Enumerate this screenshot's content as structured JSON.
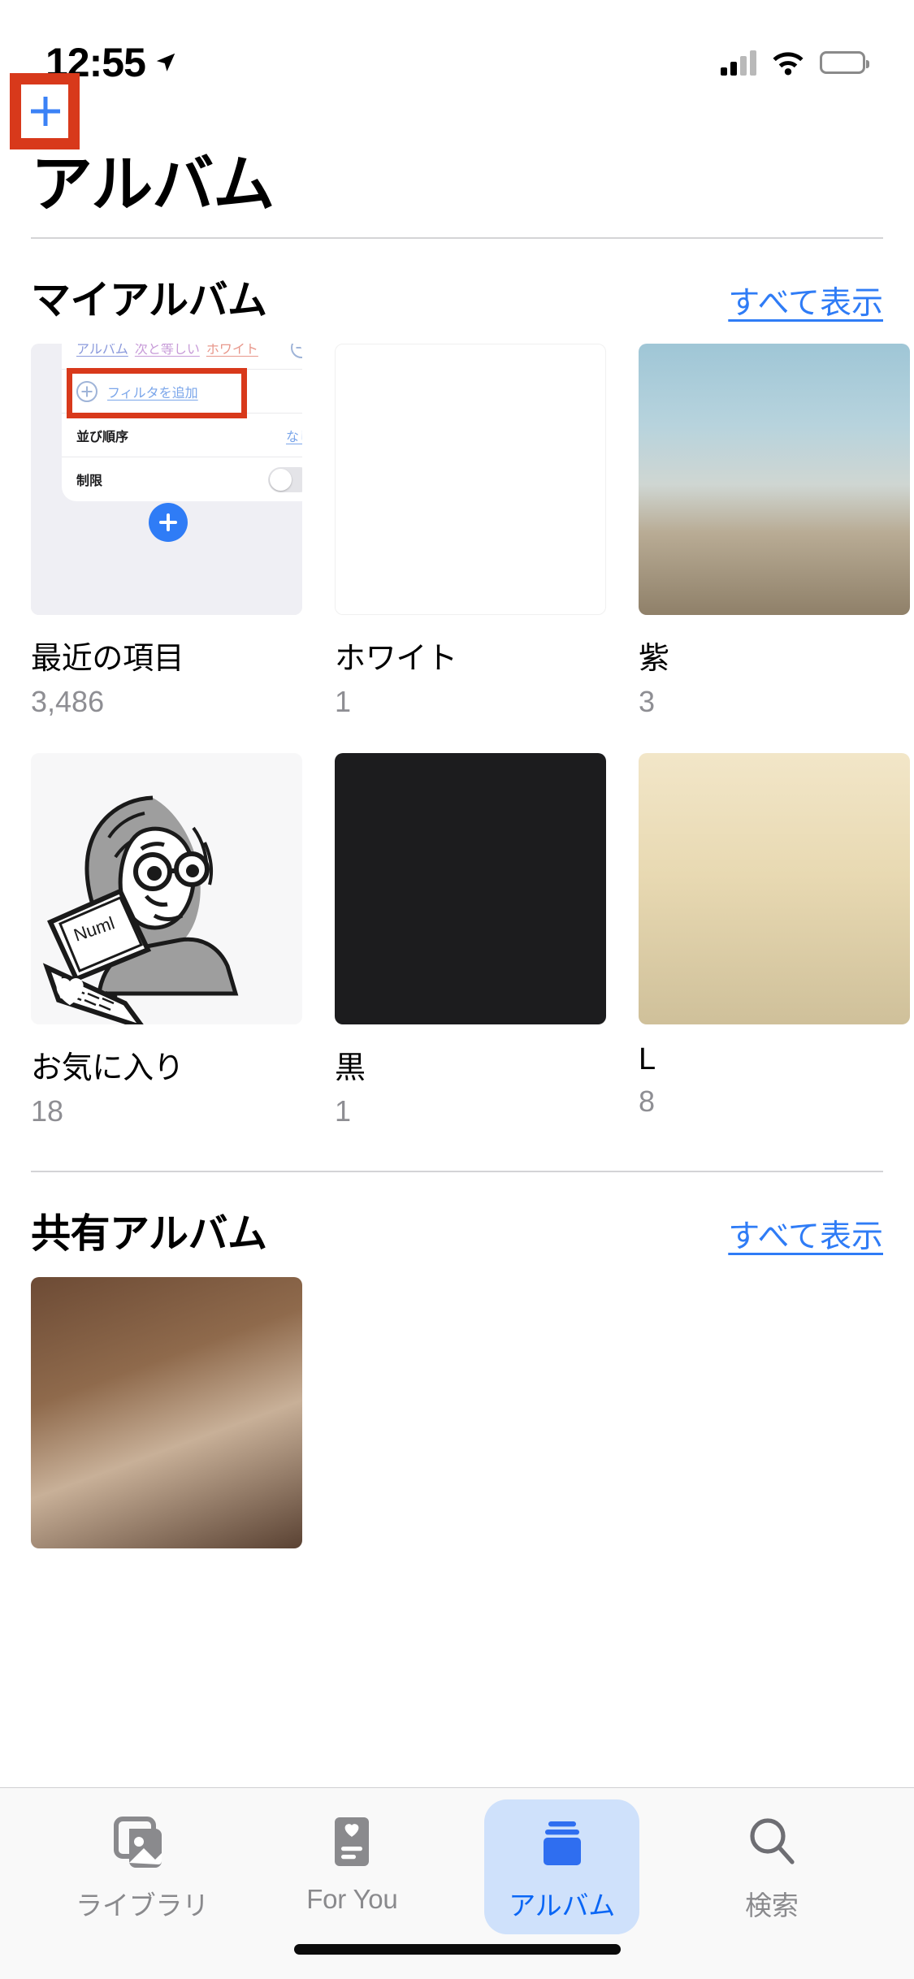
{
  "status_bar": {
    "time": "12:55",
    "location_icon": "location-arrow-icon",
    "cellular_icon": "cellular-signal-icon",
    "wifi_icon": "wifi-icon",
    "battery_icon": "battery-icon"
  },
  "nav": {
    "add_button_icon": "plus-icon",
    "add_button_label": "+",
    "highlight_color": "#d8391b"
  },
  "page_title": "アルバム",
  "sections": [
    {
      "id": "my-albums",
      "title": "マイアルバム",
      "see_all": "すべて表示",
      "albums": [
        {
          "name": "最近の項目",
          "count": "3,486",
          "thumb": "smart-album-screenshot"
        },
        {
          "name": "ホワイト",
          "count": "1",
          "thumb": "white"
        },
        {
          "name": "紫",
          "count": "3",
          "thumb": "beach"
        },
        {
          "name": "お気に入り",
          "count": "18",
          "thumb": "illustration"
        },
        {
          "name": "黒",
          "count": "1",
          "thumb": "black"
        },
        {
          "name": "L",
          "count": "8",
          "thumb": "pale"
        }
      ]
    },
    {
      "id": "shared-albums",
      "title": "共有アルバム",
      "see_all": "すべて表示",
      "albums": [
        {
          "name": "",
          "count": "",
          "thumb": "shared"
        }
      ]
    }
  ],
  "thumbnail_screenshot": {
    "description": "スマートアルバムのフィルタ設定画面のスクリーンショット",
    "filter_row": {
      "token_field": "アルバム",
      "token_operator": "次と等しい",
      "token_value": "ホワイト",
      "remove_icon": "circle-minus-icon",
      "highlighted": true
    },
    "add_filter": {
      "icon": "circle-plus-icon",
      "label": "フィルタを追加"
    },
    "sort_row": {
      "label": "並び順序",
      "value": "なし"
    },
    "limit_row": {
      "label": "制限",
      "toggle_state": "off"
    },
    "fab_icon": "plus-icon"
  },
  "tabbar": {
    "items": [
      {
        "id": "library",
        "label": "ライブラリ",
        "icon": "photos-library-icon",
        "active": false
      },
      {
        "id": "for-you",
        "label": "For You",
        "icon": "for-you-heart-icon",
        "active": false
      },
      {
        "id": "albums",
        "label": "アルバム",
        "icon": "albums-stack-icon",
        "active": true
      },
      {
        "id": "search",
        "label": "検索",
        "icon": "search-icon",
        "active": false
      }
    ],
    "active_color": "#0a66f5",
    "active_pill_color": "#cfe1fb",
    "inactive_color": "#8a8a8d"
  },
  "home_indicator": "home-indicator"
}
